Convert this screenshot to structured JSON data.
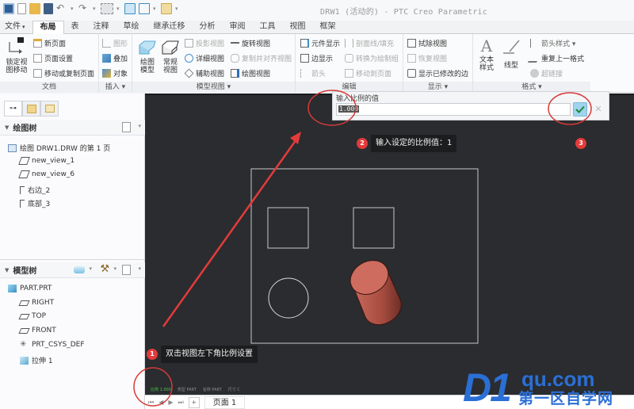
{
  "window": {
    "title": "DRW1 (活动的) - PTC Creo Parametric"
  },
  "quick_access": [
    "app-icon",
    "new-icon",
    "open-icon",
    "save-icon",
    "undo-icon",
    "redo-icon",
    "regenerate-icon",
    "window-icon",
    "switch-window-icon",
    "close-window-icon"
  ],
  "tabs": [
    {
      "label": "文件",
      "dropdown": "▾"
    },
    {
      "label": "布局",
      "active": true
    },
    {
      "label": "表"
    },
    {
      "label": "注释"
    },
    {
      "label": "草绘"
    },
    {
      "label": "继承迁移"
    },
    {
      "label": "分析"
    },
    {
      "label": "审阅"
    },
    {
      "label": "工具"
    },
    {
      "label": "视图"
    },
    {
      "label": "框架"
    }
  ],
  "ribbon": {
    "document": {
      "label": "文档",
      "lock_view_move": "锁定视图移动",
      "lock_line1": "锁定视",
      "lock_line2": "图移动",
      "new_page": "新页面",
      "page_setup": "页面设置",
      "move_copy_page": "移动或复制页面"
    },
    "insert": {
      "label": "插入 ▾",
      "graphic": "图形",
      "overlay": "叠加",
      "object": "对象"
    },
    "model_views": {
      "label": "模型视图 ▾",
      "drawing_model_l1": "绘图",
      "drawing_model_l2": "模型",
      "general_view_l1": "常规",
      "general_view_l2": "视图",
      "projection_view": "投影视图",
      "detail_view": "详细视图",
      "auxiliary_view": "辅助视图",
      "revolved_view": "旋转视图",
      "copy_align_view": "复制并对齐视图",
      "drawing_view": "绘图视图"
    },
    "edit": {
      "label": "编辑",
      "component_display": "元件显示",
      "edge_display": "边显示",
      "arrow": "箭头",
      "hatch_fill": "剖面线/填充",
      "convert_to_draft": "转换为绘制组",
      "move_to_page": "移动到页面"
    },
    "display": {
      "label": "显示 ▾",
      "erase_view": "拭除视图",
      "resume_view": "恢复视图",
      "show_modified_edges": "显示已修改的边"
    },
    "format": {
      "label": "格式 ▾",
      "text_style_l1": "文本",
      "text_style_l2": "样式",
      "line_style": "线型",
      "arrow_style": "箭头样式 ▾",
      "repeat_format": "重复上一格式",
      "hyperlink": "超链接"
    }
  },
  "left_panel": {
    "tabs": [
      "model-tree-tab-icon",
      "layers-tab-icon",
      "folder-browser-tab-icon"
    ],
    "drawing_tree": {
      "title": "绘图树",
      "items": [
        {
          "label": "绘图 DRW1.DRW 的第 1 页",
          "icon": "sheet-icon"
        },
        {
          "label": "new_view_1",
          "icon": "view-icon"
        },
        {
          "label": "new_view_6",
          "icon": "view-icon"
        },
        {
          "label": "右边_2",
          "icon": "projection-view-icon"
        },
        {
          "label": "底部_3",
          "icon": "projection-view-icon"
        }
      ]
    },
    "model_tree": {
      "title": "模型树",
      "items": [
        {
          "label": "PART.PRT",
          "icon": "part-icon"
        },
        {
          "label": "RIGHT",
          "icon": "datum-plane-icon"
        },
        {
          "label": "TOP",
          "icon": "datum-plane-icon"
        },
        {
          "label": "FRONT",
          "icon": "datum-plane-icon"
        },
        {
          "label": "PRT_CSYS_DEF",
          "icon": "csys-icon"
        },
        {
          "label": "拉伸 1",
          "icon": "extrude-icon"
        }
      ]
    }
  },
  "scale_dialog": {
    "prompt": "输入比例的值",
    "value": "1.000",
    "ok_icon": "checkmark-icon",
    "cancel_icon": "close-icon"
  },
  "status_bar": {
    "scale": "比例 1.000",
    "type": "类型 PART",
    "name": "名称 PART",
    "size": "尺寸 C"
  },
  "page_bar": {
    "nav": [
      "⏮",
      "◀",
      "▶",
      "⏭"
    ],
    "add": "+",
    "page_label": "页面 1"
  },
  "annotations": [
    {
      "num": "1",
      "text": "双击视图左下角比例设置"
    },
    {
      "num": "2",
      "text": "输入设定的比例值：1"
    },
    {
      "num": "3",
      "text": ""
    }
  ],
  "watermark": {
    "brand": "D1",
    "domain": "qu.com",
    "slogan": "第一区自学网"
  },
  "colors": {
    "accent_red": "#e23b3b",
    "graphics_bg": "#2a2c2f",
    "cylinder": "#c8665a",
    "watermark_blue": "#2a6fd6",
    "scale_green": "#4ec24e"
  }
}
